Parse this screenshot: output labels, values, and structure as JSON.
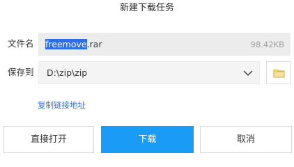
{
  "dialog": {
    "title": "新建下载任务"
  },
  "filename": {
    "label": "文件名",
    "selected_part": "freemove",
    "rest_part": ".rar",
    "size": "98.42KB"
  },
  "save_to": {
    "label": "保存到",
    "path": "D:\\zip\\zip",
    "chevron_icon": "chevron-down-icon",
    "folder_icon": "folder-icon"
  },
  "copy_link": {
    "label": "复制链接地址"
  },
  "buttons": {
    "open_directly": "直接打开",
    "download": "下载",
    "cancel": "取消"
  },
  "colors": {
    "accent": "#1a9cf6",
    "link": "#2f74e8",
    "selection": "#2f6ee6",
    "folder": "#f2cf6e"
  }
}
